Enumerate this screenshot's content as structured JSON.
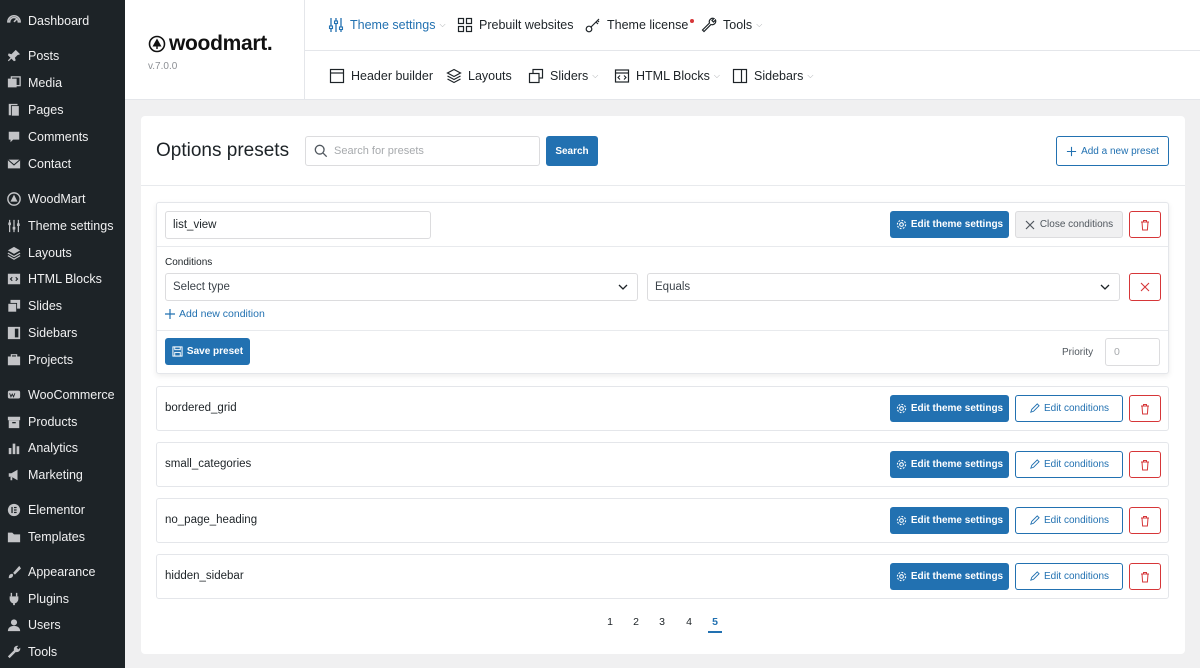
{
  "sidebar": {
    "items": [
      {
        "label": "Dashboard",
        "icon": "dashboard-icon"
      },
      {
        "label": "Posts",
        "icon": "pin-icon"
      },
      {
        "label": "Media",
        "icon": "media-icon"
      },
      {
        "label": "Pages",
        "icon": "pages-icon"
      },
      {
        "label": "Comments",
        "icon": "comment-icon"
      },
      {
        "label": "Contact",
        "icon": "mail-icon"
      },
      {
        "label": "WoodMart",
        "icon": "woodmart-icon"
      },
      {
        "label": "Theme settings",
        "icon": "sliders-icon"
      },
      {
        "label": "Layouts",
        "icon": "layers-icon"
      },
      {
        "label": "HTML Blocks",
        "icon": "html-icon"
      },
      {
        "label": "Slides",
        "icon": "slides-icon"
      },
      {
        "label": "Sidebars",
        "icon": "sidebar-icon"
      },
      {
        "label": "Projects",
        "icon": "briefcase-icon"
      },
      {
        "label": "WooCommerce",
        "icon": "woo-icon"
      },
      {
        "label": "Products",
        "icon": "archive-icon"
      },
      {
        "label": "Analytics",
        "icon": "bar-chart-icon"
      },
      {
        "label": "Marketing",
        "icon": "megaphone-icon"
      },
      {
        "label": "Elementor",
        "icon": "elementor-icon"
      },
      {
        "label": "Templates",
        "icon": "folder-icon"
      },
      {
        "label": "Appearance",
        "icon": "brush-icon"
      },
      {
        "label": "Plugins",
        "icon": "plug-icon"
      },
      {
        "label": "Users",
        "icon": "user-icon"
      },
      {
        "label": "Tools",
        "icon": "wrench-icon"
      }
    ]
  },
  "header": {
    "logo": "woodmart.",
    "version": "v.7.0.0",
    "nav_top": [
      {
        "label": "Theme settings",
        "icon": "sliders-icon",
        "dropdown": true,
        "active": true
      },
      {
        "label": "Prebuilt websites",
        "icon": "grid-icon",
        "dropdown": false
      },
      {
        "label": "Theme license",
        "icon": "key-icon",
        "dropdown": false
      },
      {
        "label": "Tools",
        "icon": "wrench-icon",
        "dropdown": true
      }
    ],
    "nav_bottom": [
      {
        "label": "Header builder",
        "icon": "window-icon",
        "dropdown": false
      },
      {
        "label": "Layouts",
        "icon": "layers-icon",
        "dropdown": false
      },
      {
        "label": "Sliders",
        "icon": "slides-icon",
        "dropdown": true
      },
      {
        "label": "HTML Blocks",
        "icon": "html-icon",
        "dropdown": true
      },
      {
        "label": "Sidebars",
        "icon": "sidebar-icon",
        "dropdown": true
      }
    ]
  },
  "main": {
    "title": "Options presets",
    "search_placeholder": "Search for presets",
    "search_button": "Search",
    "add_button": "Add a new preset",
    "expanded_preset": {
      "name": "list_view",
      "edit_button": "Edit theme settings",
      "close_button": "Close conditions",
      "conditions_label": "Conditions",
      "select_type": "Select type",
      "comparison": "Equals",
      "add_condition": "Add new condition",
      "save_button": "Save preset",
      "priority_label": "Priority",
      "priority_placeholder": "0"
    },
    "presets": [
      {
        "name": "bordered_grid",
        "edit": "Edit theme settings",
        "conditions": "Edit conditions"
      },
      {
        "name": "small_categories",
        "edit": "Edit theme settings",
        "conditions": "Edit conditions"
      },
      {
        "name": "no_page_heading",
        "edit": "Edit theme settings",
        "conditions": "Edit conditions"
      },
      {
        "name": "hidden_sidebar",
        "edit": "Edit theme settings",
        "conditions": "Edit conditions"
      }
    ],
    "pagination": [
      "1",
      "2",
      "3",
      "4",
      "5"
    ],
    "current_page": "5"
  },
  "colors": {
    "accent": "#2271b1",
    "sidebar_bg": "#1d2327",
    "danger": "#d63638"
  }
}
